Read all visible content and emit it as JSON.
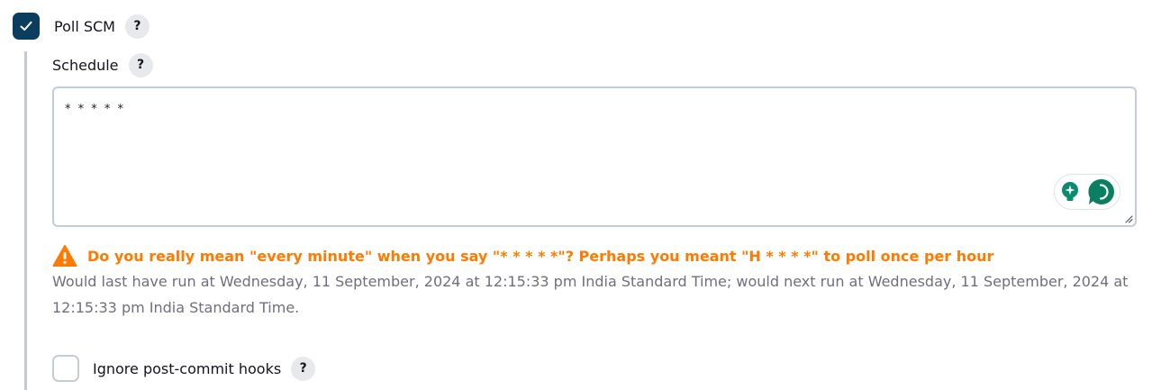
{
  "poll_scm": {
    "label": "Poll SCM",
    "checked": true,
    "help": "?"
  },
  "schedule": {
    "label": "Schedule",
    "help": "?",
    "value": "* * * * *"
  },
  "warning": {
    "text": "Do you really mean \"every minute\" when you say \"* * * * *\"? Perhaps you meant \"H * * * *\" to poll once per hour",
    "color": "#ff7a00"
  },
  "run_info": {
    "text": "Would last have run at Wednesday, 11 September, 2024 at 12:15:33 pm India Standard Time; would next run at Wednesday, 11 September, 2024 at 12:15:33 pm India Standard Time."
  },
  "ignore_hooks": {
    "label": "Ignore post-commit hooks",
    "checked": false,
    "help": "?"
  },
  "icons": {
    "checkbox_check": "checkmark-icon",
    "assist_bulb": "lightbulb-icon",
    "assist_chat": "chat-bubble-icon",
    "warning": "warning-triangle-icon"
  },
  "colors": {
    "checkbox_checked": "#0b3d5e",
    "assist_accent": "#0a8a6e",
    "warning": "#ff7a00",
    "muted_text": "#6f6f7d"
  }
}
